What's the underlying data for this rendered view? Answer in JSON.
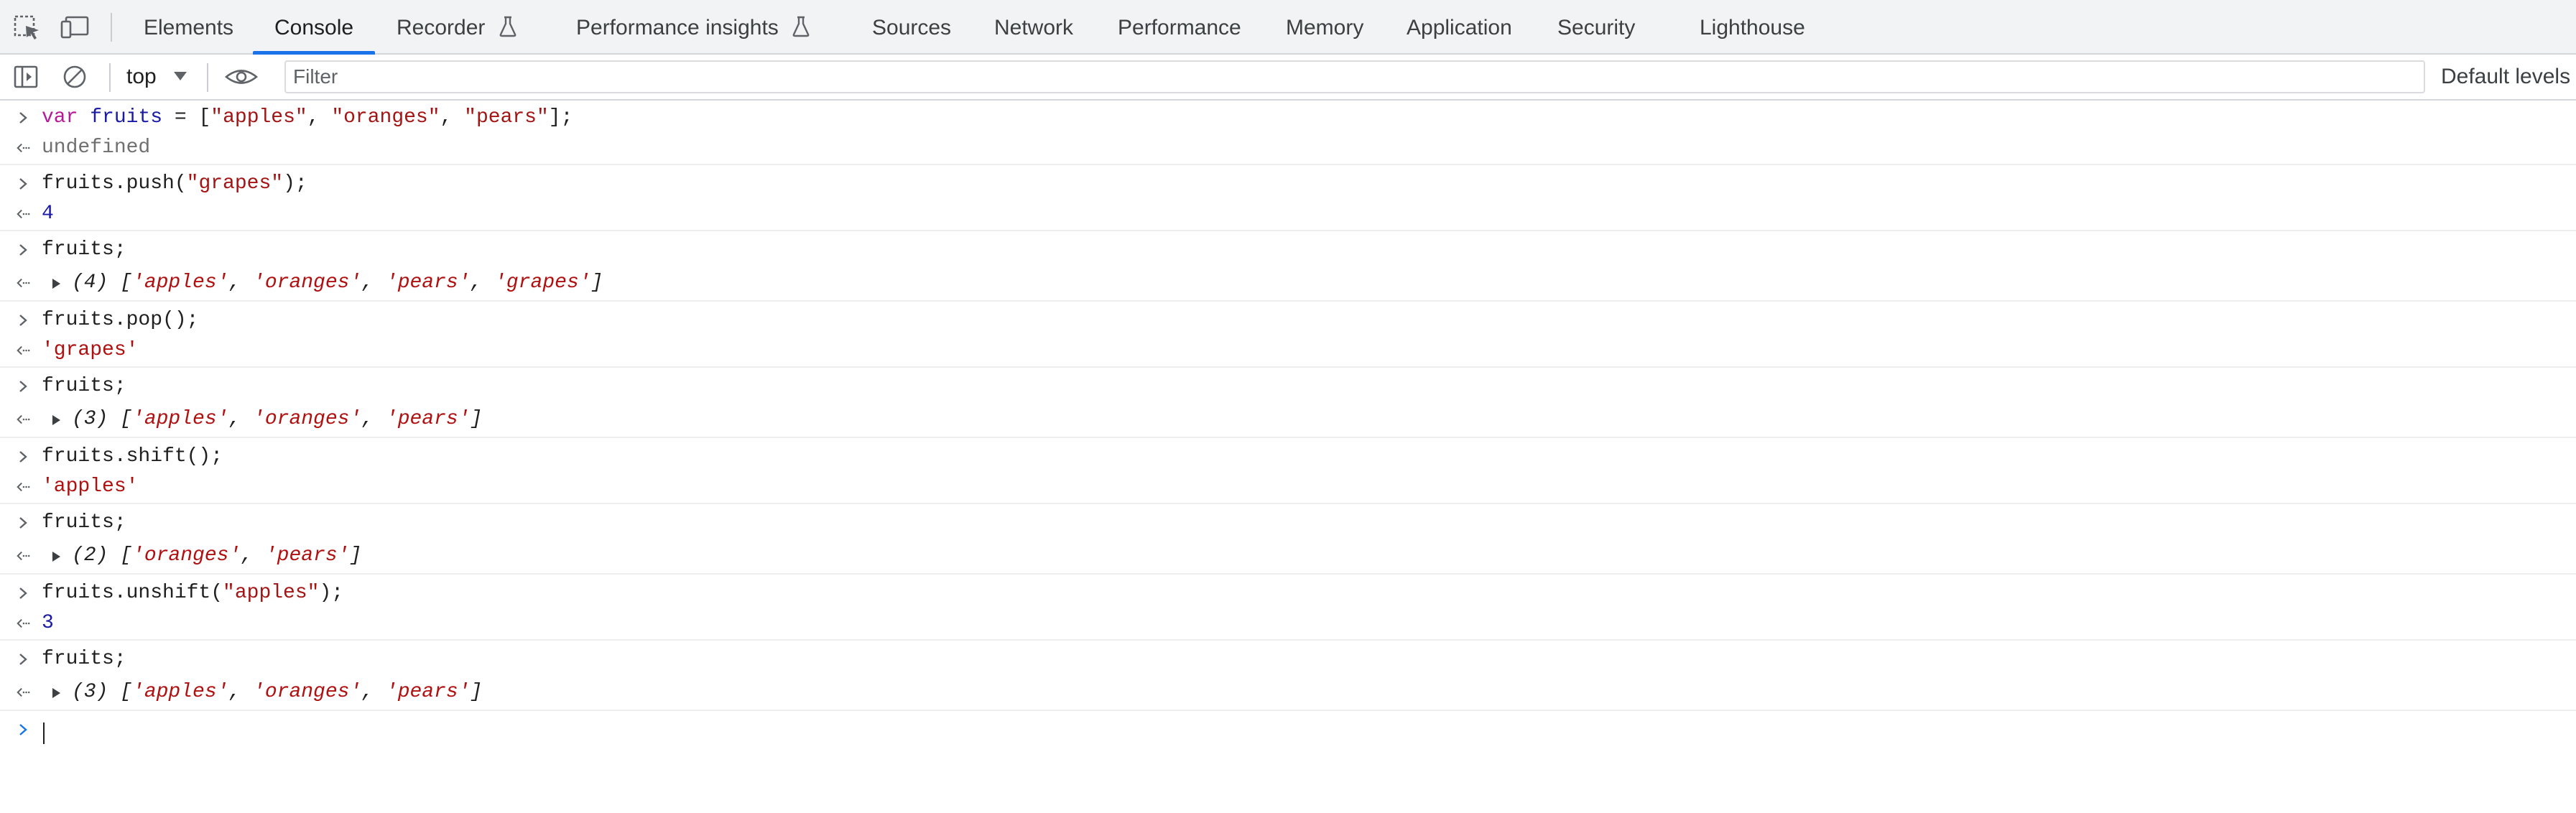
{
  "tabs": [
    {
      "label": "Elements",
      "active": false
    },
    {
      "label": "Console",
      "active": true
    },
    {
      "label": "Recorder",
      "active": false,
      "experimental": true
    },
    {
      "label": "Performance insights",
      "active": false,
      "experimental": true
    },
    {
      "label": "Sources",
      "active": false
    },
    {
      "label": "Network",
      "active": false
    },
    {
      "label": "Performance",
      "active": false
    },
    {
      "label": "Memory",
      "active": false
    },
    {
      "label": "Application",
      "active": false
    },
    {
      "label": "Security",
      "active": false
    },
    {
      "label": "Lighthouse",
      "active": false
    }
  ],
  "toolbar": {
    "context": "top",
    "filter_placeholder": "Filter",
    "levels_label": "Default levels"
  },
  "colors": {
    "accent": "#1a73e8",
    "string": "#a31515",
    "keyword": "#b41b99",
    "number": "#1a1aa6",
    "muted": "#707070"
  },
  "console": {
    "entries": [
      {
        "input": [
          {
            "t": "var",
            "c": "kw"
          },
          {
            "t": " ",
            "c": "pl"
          },
          {
            "t": "fruits",
            "c": "var"
          },
          {
            "t": " = [",
            "c": "pl"
          },
          {
            "t": "\"apples\"",
            "c": "str"
          },
          {
            "t": ", ",
            "c": "pl"
          },
          {
            "t": "\"oranges\"",
            "c": "str"
          },
          {
            "t": ", ",
            "c": "pl"
          },
          {
            "t": "\"pears\"",
            "c": "str"
          },
          {
            "t": "];",
            "c": "pl"
          }
        ],
        "output_type": "plain",
        "output": [
          {
            "t": "undefined",
            "c": "undef"
          }
        ]
      },
      {
        "input": [
          {
            "t": "fruits.push(",
            "c": "pl"
          },
          {
            "t": "\"grapes\"",
            "c": "str"
          },
          {
            "t": ");",
            "c": "pl"
          }
        ],
        "output_type": "plain",
        "output": [
          {
            "t": "4",
            "c": "num"
          }
        ]
      },
      {
        "input": [
          {
            "t": "fruits;",
            "c": "pl"
          }
        ],
        "output_type": "array",
        "output": [
          {
            "t": "(4) [",
            "c": "pl"
          },
          {
            "t": "'apples'",
            "c": "str2"
          },
          {
            "t": ", ",
            "c": "pl"
          },
          {
            "t": "'oranges'",
            "c": "str2"
          },
          {
            "t": ", ",
            "c": "pl"
          },
          {
            "t": "'pears'",
            "c": "str2"
          },
          {
            "t": ", ",
            "c": "pl"
          },
          {
            "t": "'grapes'",
            "c": "str2"
          },
          {
            "t": "]",
            "c": "pl"
          }
        ]
      },
      {
        "input": [
          {
            "t": "fruits.pop();",
            "c": "pl"
          }
        ],
        "output_type": "plain",
        "output": [
          {
            "t": "'grapes'",
            "c": "str2"
          }
        ]
      },
      {
        "input": [
          {
            "t": "fruits;",
            "c": "pl"
          }
        ],
        "output_type": "array",
        "output": [
          {
            "t": "(3) [",
            "c": "pl"
          },
          {
            "t": "'apples'",
            "c": "str2"
          },
          {
            "t": ", ",
            "c": "pl"
          },
          {
            "t": "'oranges'",
            "c": "str2"
          },
          {
            "t": ", ",
            "c": "pl"
          },
          {
            "t": "'pears'",
            "c": "str2"
          },
          {
            "t": "]",
            "c": "pl"
          }
        ]
      },
      {
        "input": [
          {
            "t": "fruits.shift();",
            "c": "pl"
          }
        ],
        "output_type": "plain",
        "output": [
          {
            "t": "'apples'",
            "c": "str2"
          }
        ]
      },
      {
        "input": [
          {
            "t": "fruits;",
            "c": "pl"
          }
        ],
        "output_type": "array",
        "output": [
          {
            "t": "(2) [",
            "c": "pl"
          },
          {
            "t": "'oranges'",
            "c": "str2"
          },
          {
            "t": ", ",
            "c": "pl"
          },
          {
            "t": "'pears'",
            "c": "str2"
          },
          {
            "t": "]",
            "c": "pl"
          }
        ]
      },
      {
        "input": [
          {
            "t": "fruits.unshift(",
            "c": "pl"
          },
          {
            "t": "\"apples\"",
            "c": "str"
          },
          {
            "t": ");",
            "c": "pl"
          }
        ],
        "output_type": "plain",
        "output": [
          {
            "t": "3",
            "c": "num"
          }
        ]
      },
      {
        "input": [
          {
            "t": "fruits;",
            "c": "pl"
          }
        ],
        "output_type": "array",
        "output": [
          {
            "t": "(3) [",
            "c": "pl"
          },
          {
            "t": "'apples'",
            "c": "str2"
          },
          {
            "t": ", ",
            "c": "pl"
          },
          {
            "t": "'oranges'",
            "c": "str2"
          },
          {
            "t": ", ",
            "c": "pl"
          },
          {
            "t": "'pears'",
            "c": "str2"
          },
          {
            "t": "]",
            "c": "pl"
          }
        ]
      }
    ]
  }
}
